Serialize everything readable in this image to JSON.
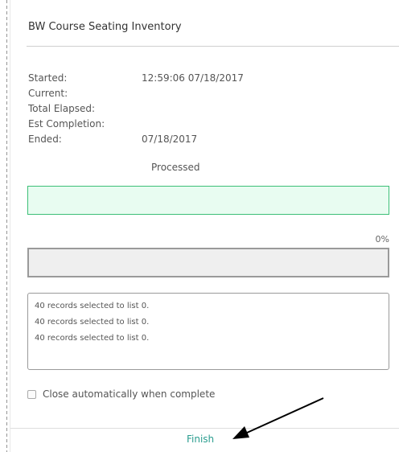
{
  "dialog": {
    "title": "BW Course Seating Inventory"
  },
  "stats": {
    "started_label": "Started:",
    "started_value": "12:59:06 07/18/2017",
    "current_label": "Current:",
    "current_value": "",
    "total_elapsed_label": "Total Elapsed:",
    "total_elapsed_value": "",
    "est_completion_label": "Est Completion:",
    "est_completion_value": "",
    "ended_label": "Ended:",
    "ended_value": "07/18/2017"
  },
  "progress": {
    "processed_label": "Processed",
    "main_fill": 1.0,
    "secondary_percent_text": "0%",
    "secondary_fill": 0.0
  },
  "log": {
    "lines": [
      "40 records selected to list 0.",
      "40 records selected to list 0.",
      "40 records selected to list 0."
    ]
  },
  "options": {
    "close_automatically_label": "Close automatically when complete",
    "close_automatically_checked": false
  },
  "footer": {
    "finish_label": "Finish"
  },
  "colors": {
    "success_fill": "#e8fcf1",
    "success_border": "#3cbf77",
    "finish_link": "#2a9d8f"
  },
  "icons": {
    "annotation": "arrow-icon"
  }
}
